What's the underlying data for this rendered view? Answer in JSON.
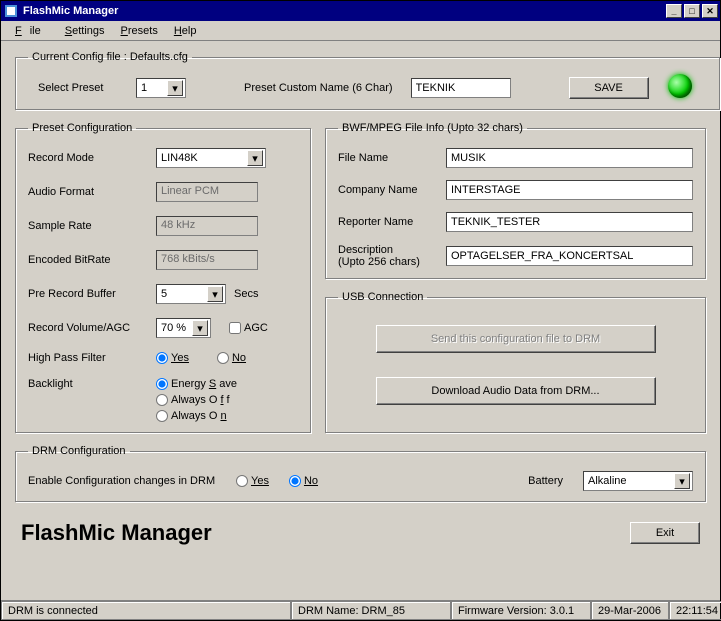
{
  "window": {
    "title": "FlashMic Manager"
  },
  "menu": {
    "file": "File",
    "settings": "Settings",
    "presets": "Presets",
    "help": "Help"
  },
  "config": {
    "legend": "Current Config file : Defaults.cfg",
    "selectPresetLabel": "Select Preset",
    "selectPresetValue": "1",
    "customNameLabel": "Preset Custom Name (6 Char)",
    "customNameValue": "TEKNIK",
    "saveLabel": "SAVE"
  },
  "preset": {
    "legend": "Preset Configuration",
    "recordModeLabel": "Record Mode",
    "recordModeValue": "LIN48K",
    "audioFormatLabel": "Audio Format",
    "audioFormatValue": "Linear PCM",
    "sampleRateLabel": "Sample Rate",
    "sampleRateValue": "48 kHz",
    "bitRateLabel": "Encoded BitRate",
    "bitRateValue": "768 kBits/s",
    "preRecLabel": "Pre Record Buffer",
    "preRecValue": "5",
    "secs": "Secs",
    "volAgcLabel": "Record Volume/AGC",
    "volAgcValue": "70 %",
    "agc": "AGC",
    "hpfLabel": "High Pass Filter",
    "yes": "Yes",
    "no": "No",
    "backlightLabel": "Backlight",
    "energySave": "Energy Save",
    "alwaysOff": "Always Off",
    "alwaysOn": "Always On"
  },
  "bwf": {
    "legend": "BWF/MPEG File Info (Upto 32 chars)",
    "fileNameLabel": "File Name",
    "fileNameValue": "MUSIK",
    "companyLabel": "Company Name",
    "companyValue": "INTERSTAGE",
    "reporterLabel": "Reporter Name",
    "reporterValue": "TEKNIK_TESTER",
    "descLabel1": "Description",
    "descLabel2": "(Upto 256 chars)",
    "descValue": "OPTAGELSER_FRA_KONCERTSAL"
  },
  "usb": {
    "legend": "USB Connection",
    "sendBtn": "Send this configuration file to DRM",
    "downloadBtn": "Download Audio Data from DRM..."
  },
  "drm": {
    "legend": "DRM Configuration",
    "enableLabel": "Enable Configuration changes in DRM",
    "yes": "Yes",
    "no": "No",
    "batteryLabel": "Battery",
    "batteryValue": "Alkaline"
  },
  "footer": {
    "appTitle": "FlashMic Manager",
    "exit": "Exit"
  },
  "status": {
    "connected": "DRM is connected",
    "drmName": "DRM Name: DRM_85",
    "firmware": "Firmware Version: 3.0.1",
    "date": "29-Mar-2006",
    "time": "22:11:54"
  }
}
